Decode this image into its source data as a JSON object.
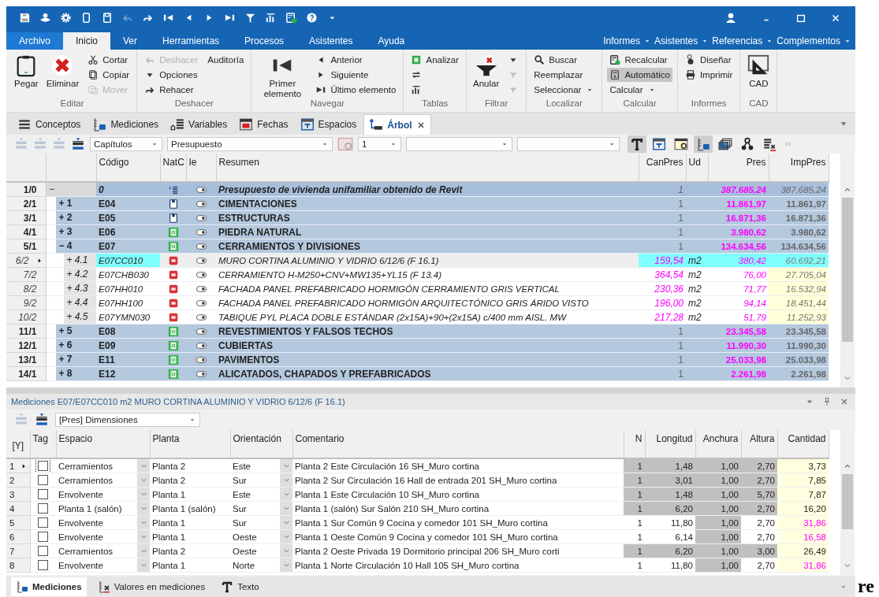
{
  "menu_tabs": [
    {
      "label": "Archivo",
      "kind": "file",
      "selected": false
    },
    {
      "label": "Inicio",
      "kind": "tab",
      "selected": true
    },
    {
      "label": "Ver",
      "kind": "tab",
      "selected": false
    },
    {
      "label": "Herramientas",
      "kind": "tab",
      "selected": false
    },
    {
      "label": "Procesos",
      "kind": "tab",
      "selected": false
    },
    {
      "label": "Asistentes",
      "kind": "tab",
      "selected": false
    },
    {
      "label": "Ayuda",
      "kind": "tab",
      "selected": false
    }
  ],
  "menu_right": [
    {
      "label": "Informes"
    },
    {
      "label": "Asistentes"
    },
    {
      "label": "Referencias"
    },
    {
      "label": "Complementos"
    }
  ],
  "ribbon_groups": [
    {
      "label": "Editar",
      "columns": [
        {
          "kind": "large",
          "items": [
            {
              "label": "Pegar",
              "disabled": false,
              "pressed": false
            }
          ]
        },
        {
          "kind": "large",
          "items": [
            {
              "label": "Eliminar",
              "disabled": false,
              "pressed": false
            }
          ]
        },
        {
          "kind": "stack",
          "items": [
            {
              "label": "Cortar",
              "disabled": false,
              "pressed": false
            },
            {
              "label": "Copiar",
              "disabled": false,
              "pressed": false
            },
            {
              "label": "Mover",
              "disabled": true,
              "pressed": false
            }
          ]
        }
      ]
    },
    {
      "label": "Deshacer",
      "columns": [
        {
          "kind": "stack",
          "items": [
            {
              "label": "Deshacer",
              "disabled": true,
              "pressed": false
            },
            {
              "label": "Opciones",
              "disabled": false,
              "pressed": false
            },
            {
              "label": "Rehacer",
              "disabled": false,
              "pressed": false
            }
          ]
        },
        {
          "kind": "stack",
          "items": [
            {
              "label": "Auditoría",
              "disabled": false,
              "pressed": false
            }
          ]
        }
      ]
    },
    {
      "label": "Navegar",
      "columns": [
        {
          "kind": "large",
          "items": [
            {
              "label": "Primer elemento",
              "disabled": false,
              "pressed": false
            }
          ]
        },
        {
          "kind": "stack",
          "items": [
            {
              "label": "Anterior",
              "disabled": false,
              "pressed": false
            },
            {
              "label": "Siguiente",
              "disabled": false,
              "pressed": false
            },
            {
              "label": "Último elemento",
              "disabled": false,
              "pressed": false
            }
          ]
        }
      ]
    },
    {
      "label": "Tablas",
      "columns": [
        {
          "kind": "stack",
          "items": [
            {
              "label": "Analizar",
              "disabled": false,
              "pressed": false
            },
            {
              "disabled": false,
              "pressed": false
            },
            {
              "disabled": false,
              "pressed": false
            }
          ]
        }
      ]
    },
    {
      "label": "Filtrar",
      "columns": [
        {
          "kind": "large",
          "items": [
            {
              "label": "Anular",
              "disabled": false,
              "pressed": false
            }
          ]
        },
        {
          "kind": "stack",
          "items": [
            {
              "disabled": false,
              "pressed": false
            },
            {
              "disabled": true,
              "pressed": false
            },
            {
              "disabled": true,
              "pressed": false
            }
          ]
        }
      ]
    },
    {
      "label": "Localizar",
      "columns": [
        {
          "kind": "stack",
          "items": [
            {
              "label": "Buscar",
              "disabled": false,
              "pressed": false
            },
            {
              "label": "Reemplazar",
              "disabled": false,
              "pressed": false
            },
            {
              "label": "Seleccionar",
              "disabled": false,
              "pressed": false,
              "dropdown": true
            }
          ]
        }
      ]
    },
    {
      "label": "Calcular",
      "columns": [
        {
          "kind": "stack",
          "items": [
            {
              "label": "Recalcular",
              "disabled": false,
              "pressed": false
            },
            {
              "label": "Automático",
              "disabled": false,
              "pressed": true
            },
            {
              "label": "Calcular",
              "disabled": false,
              "pressed": false,
              "dropdown": true
            }
          ]
        }
      ]
    },
    {
      "label": "Informes",
      "columns": [
        {
          "kind": "stack",
          "items": [
            {
              "label": "Diseñar",
              "disabled": false,
              "pressed": false
            },
            {
              "label": "Imprimir",
              "disabled": false,
              "pressed": false
            }
          ]
        }
      ]
    },
    {
      "label": "CAD",
      "columns": [
        {
          "kind": "large",
          "items": [
            {
              "label": "CAD",
              "disabled": false,
              "pressed": false
            }
          ]
        }
      ]
    }
  ],
  "doc_tabs": [
    {
      "label": "Conceptos",
      "selected": false,
      "closable": false
    },
    {
      "label": "Mediciones",
      "selected": false,
      "closable": false
    },
    {
      "label": "Variables",
      "selected": false,
      "closable": false
    },
    {
      "label": "Fechas",
      "selected": false,
      "closable": false
    },
    {
      "label": "Espacios",
      "selected": false,
      "closable": false
    },
    {
      "label": "Árbol",
      "selected": true,
      "closable": true
    }
  ],
  "toolbar": {
    "selects": [
      {
        "value": "Capítulos"
      },
      {
        "value": "Presupuesto"
      },
      {
        "value": "1"
      }
    ],
    "toggles": [
      {
        "selected": true
      },
      {
        "selected": false
      },
      {
        "selected": false
      },
      {
        "selected": true
      },
      {
        "selected": false
      },
      {
        "selected": false
      },
      {
        "selected": false
      }
    ]
  },
  "tree_table": {
    "columns": [
      "Código",
      "NatC",
      "Ie",
      "Resumen",
      "CanPres",
      "Ud",
      "Pres",
      "ImpPres"
    ],
    "rows": [
      {
        "num": "1/0",
        "kind": "root",
        "outline": "−",
        "code": "0",
        "natc": {
          "kind": "root"
        },
        "summary": "Presupuesto de vivienda unifamiliar obtenido de Revit",
        "canpres": "1",
        "pres": "387.685,24",
        "imppres": "387.685,24",
        "selected": false
      },
      {
        "num": "2/1",
        "kind": "chapter",
        "outline": "+ 1",
        "code": "E04",
        "natc": {
          "kind": "page"
        },
        "summary": "CIMENTACIONES",
        "canpres": "1",
        "pres": "11.861,97",
        "imppres": "11.861,97",
        "selected": false
      },
      {
        "num": "3/1",
        "kind": "chapter",
        "outline": "+ 2",
        "code": "E05",
        "natc": {
          "kind": "page"
        },
        "summary": "ESTRUCTURAS",
        "canpres": "1",
        "pres": "16.871,36",
        "imppres": "16.871,36",
        "selected": false
      },
      {
        "num": "4/1",
        "kind": "chapter",
        "outline": "+ 3",
        "code": "E06",
        "natc": {
          "kind": "sheet"
        },
        "summary": "PIEDRA NATURAL",
        "canpres": "1",
        "pres": "3.980,62",
        "imppres": "3.980,62",
        "selected": false
      },
      {
        "num": "5/1",
        "kind": "chapter",
        "outline": "− 4",
        "code": "E07",
        "natc": {
          "kind": "sheet"
        },
        "summary": "CERRAMIENTOS Y DIVISIONES",
        "canpres": "1",
        "pres": "134.634,56",
        "imppres": "134.634,56",
        "selected": false
      },
      {
        "num": "6/2",
        "kind": "item",
        "outline": "+ 4.1",
        "code": "E07CC010",
        "natc": {
          "kind": "unit"
        },
        "summary": "MURO CORTINA ALUMINIO Y VIDRIO 6/12/6 (F 16.1)",
        "canpres": "159,54",
        "ud": "m2",
        "pres": "380,42",
        "imppres": "60.692,21",
        "selected": true
      },
      {
        "num": "7/2",
        "kind": "item",
        "outline": "+ 4.2",
        "code": "E07CHB030",
        "natc": {
          "kind": "unit"
        },
        "summary": "CERRAMIENTO H-M250+CNV+MW135+YL15 (F 13.4)",
        "canpres": "364,54",
        "ud": "m2",
        "pres": "76,00",
        "imppres": "27.705,04",
        "selected": false
      },
      {
        "num": "8/2",
        "kind": "item",
        "outline": "+ 4.3",
        "code": "E07HH010",
        "natc": {
          "kind": "unit"
        },
        "summary": "FACHADA PANEL PREFABRICADO HORMIGÓN CERRAMIENTO GRIS VERTICAL",
        "canpres": "230,36",
        "ud": "m2",
        "pres": "71,77",
        "imppres": "16.532,94",
        "selected": false
      },
      {
        "num": "9/2",
        "kind": "item",
        "outline": "+ 4.4",
        "code": "E07HH100",
        "natc": {
          "kind": "unit"
        },
        "summary": "FACHADA PANEL PREFABRICADO HORMIGÓN ARQUITECTÓNICO GRIS ÁRIDO VISTO",
        "canpres": "196,00",
        "ud": "m2",
        "pres": "94,14",
        "imppres": "18.451,44",
        "selected": false
      },
      {
        "num": "10/2",
        "kind": "item",
        "outline": "+ 4.5",
        "code": "E07YMN030",
        "natc": {
          "kind": "unit"
        },
        "summary": "TABIQUE PYL PLACA DOBLE ESTÁNDAR (2x15A)+90+(2x15A) c/400 mm AISL. MW",
        "canpres": "217,28",
        "ud": "m2",
        "pres": "51,79",
        "imppres": "11.252,93",
        "selected": false
      },
      {
        "num": "11/1",
        "kind": "chapter",
        "outline": "+ 5",
        "code": "E08",
        "natc": {
          "kind": "sheet"
        },
        "summary": "REVESTIMIENTOS Y FALSOS TECHOS",
        "canpres": "1",
        "pres": "23.345,58",
        "imppres": "23.345,58",
        "selected": false
      },
      {
        "num": "12/1",
        "kind": "chapter",
        "outline": "+ 6",
        "code": "E09",
        "natc": {
          "kind": "sheet"
        },
        "summary": "CUBIERTAS",
        "canpres": "1",
        "pres": "11.990,30",
        "imppres": "11.990,30",
        "selected": false
      },
      {
        "num": "13/1",
        "kind": "chapter",
        "outline": "+ 7",
        "code": "E11",
        "natc": {
          "kind": "sheet"
        },
        "summary": "PAVIMENTOS",
        "canpres": "1",
        "pres": "25.033,98",
        "imppres": "25.033,98",
        "selected": false
      },
      {
        "num": "14/1",
        "kind": "chapter",
        "outline": "+ 8",
        "code": "E12",
        "natc": {
          "kind": "sheet"
        },
        "summary": "ALICATADOS, CHAPADOS Y PREFABRICADOS",
        "canpres": "1",
        "pres": "2.261,98",
        "imppres": "2.261,98",
        "selected": false
      }
    ]
  },
  "measurements": {
    "title": "Mediciones E07/E07CC010 m2 MURO CORTINA ALUMINIO Y VIDRIO 6/12/6 (F 16.1)",
    "view": "[Pres] Dimensiones",
    "columns": [
      "[Y]",
      "Tag",
      "Espacio",
      "Planta",
      "Orientación",
      "Comentario",
      "N",
      "Longitud",
      "Anchura",
      "Altura",
      "Cantidad"
    ],
    "rows": [
      {
        "num": "1",
        "selected": true,
        "checked": false,
        "espacio": "Cerramientos",
        "planta": "Planta 2",
        "orientacion": "Este",
        "comentario": "Planta 2 Este Circulación 16 SH_Muro cortina",
        "n": "1",
        "longitud": "1,48",
        "anchura": "1,00",
        "altura": "2,70",
        "cantidad": "3,73",
        "shaded": true,
        "flagged": false
      },
      {
        "num": "2",
        "selected": false,
        "checked": false,
        "espacio": "Cerramientos",
        "planta": "Planta 2",
        "orientacion": "Sur",
        "comentario": "Planta 2 Sur Circulación 16 Hall de entrada 201 SH_Muro cortina",
        "n": "1",
        "longitud": "3,01",
        "anchura": "1,00",
        "altura": "2,70",
        "cantidad": "7,85",
        "shaded": true,
        "flagged": false
      },
      {
        "num": "3",
        "selected": false,
        "checked": false,
        "espacio": "Envolvente",
        "planta": "Planta 1",
        "orientacion": "Este",
        "comentario": "Planta 1 Este Circulación 10 SH_Muro cortina",
        "n": "1",
        "longitud": "1,48",
        "anchura": "1,00",
        "altura": "5,70",
        "cantidad": "7,87",
        "shaded": true,
        "flagged": false
      },
      {
        "num": "4",
        "selected": false,
        "checked": false,
        "espacio": "Planta 1 (salón)",
        "planta": "Planta 1 (salón)",
        "orientacion": "Sur",
        "comentario": "Planta 1 (salón) Sur Salón 210 SH_Muro cortina",
        "n": "1",
        "longitud": "6,20",
        "anchura": "1,00",
        "altura": "2,70",
        "cantidad": "16,20",
        "shaded": true,
        "flagged": false
      },
      {
        "num": "5",
        "selected": false,
        "checked": false,
        "espacio": "Envolvente",
        "planta": "Planta 1",
        "orientacion": "Sur",
        "comentario": "Planta 1 Sur Común 9 Cocina y comedor 101 SH_Muro cortina",
        "n": "1",
        "longitud": "11,80",
        "anchura": "1,00",
        "altura": "2,70",
        "cantidad": "31,86",
        "shaded": false,
        "flagged": true
      },
      {
        "num": "6",
        "selected": false,
        "checked": false,
        "espacio": "Envolvente",
        "planta": "Planta 1",
        "orientacion": "Oeste",
        "comentario": "Planta 1 Oeste Común 9 Cocina y comedor 101 SH_Muro cortina",
        "n": "1",
        "longitud": "6,14",
        "anchura": "1,00",
        "altura": "2,70",
        "cantidad": "16,58",
        "shaded": false,
        "flagged": true
      },
      {
        "num": "7",
        "selected": false,
        "checked": false,
        "espacio": "Cerramientos",
        "planta": "Planta 2",
        "orientacion": "Oeste",
        "comentario": "Planta 2 Oeste Privada 19 Dormitorio principal 206 SH_Muro corti",
        "n": "1",
        "longitud": "6,20",
        "anchura": "1,00",
        "altura": "3,00",
        "cantidad": "26,49",
        "shaded": true,
        "flagged": false
      },
      {
        "num": "8",
        "selected": false,
        "checked": false,
        "espacio": "Envolvente",
        "planta": "Planta 1",
        "orientacion": "Norte",
        "comentario": "Planta 1 Norte Circulación 10 Hall 105 SH_Muro cortina",
        "n": "1",
        "longitud": "11,80",
        "anchura": "1,00",
        "altura": "2,70",
        "cantidad": "31,86",
        "shaded": false,
        "flagged": true
      }
    ]
  },
  "bottom_tabs": [
    {
      "label": "Mediciones",
      "selected": true
    },
    {
      "label": "Valores en mediciones",
      "selected": false
    },
    {
      "label": "Texto",
      "selected": false
    }
  ],
  "page_fragment": "re"
}
